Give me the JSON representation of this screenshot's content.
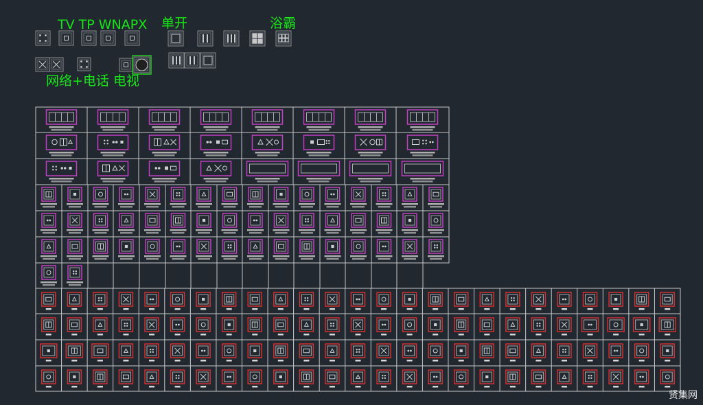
{
  "labels": {
    "tv_tp_wnapx": "TV TP WNAPX",
    "single_switch": "单开",
    "bath_heater": "浴霸",
    "network_phone_tv": "网络+电话 电视"
  },
  "watermark": "贤集网",
  "colors": {
    "background": "#212830",
    "label_green": "#19e619",
    "grid_line": "#c8c8c8",
    "magenta_frame": "#c040c0",
    "red_frame": "#d03030",
    "symbol_line": "#d0d0d0",
    "selection_green": "#22cc22"
  }
}
